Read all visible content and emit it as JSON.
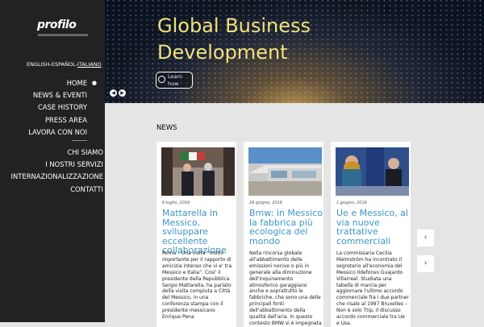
{
  "sidebar": {
    "logo": "profilo",
    "languages": {
      "text": "ENGLISH-ESPAÑOL-",
      "active": "ITALIANO"
    },
    "menu_primary": [
      "HOME",
      "NEWS & EVENTI",
      "CASE HISTORY",
      "PRESS AREA",
      "LAVORA CON NOI"
    ],
    "menu_secondary": [
      "CHI SIAMO",
      "I NOSTRI SERVIZI",
      "INTERNAZIONALIZZAZIONE",
      "CONTATTI"
    ]
  },
  "hero": {
    "title": "Global Business Development",
    "button": "Learn how"
  },
  "news": {
    "title": "NEWS",
    "cards": [
      {
        "date": "6 luglio, 2016",
        "title": "Mattarella in Messico, sviluppare eccellente collaborazione",
        "body": "Roma – Una visita “molto importante per il rapporto di amicizia intenso che vi e' tra Messico e Italia”. Cosi' il presidente della Repubblica Sergio Mattarella, ha parlato della visita compiuta a Città del Messico, in una conferenza stampa con il presidente messicano Enrique Pena"
      },
      {
        "date": "29 giugno, 2016",
        "title": "Bmw: in Messico la fabbrica più ecologica del mondo",
        "body": "Nella rincorsa globale all'abbattimento delle emissioni nocive o più in generale alla diminuzione dell'inquinamento atmosferico garaggiano anche e soprattutto le fabbriche, che sono una delle principali fonti dell'abbattimento della qualità dell'aria. In questo contesto BMW si è impegnata per"
      },
      {
        "date": "1 giugno, 2016",
        "title": "Ue e Messico, al via nuove trattative commerciali",
        "body": "La commissaria Cecilia Malmström ha incontrato il segretario all'economia del Messico Ildefonso Guajardo Villarreal. Studiata una tabella di marcia per aggiornare l'ultimo accordo commerciale fra i due partner che risale al 1997 Bruxelles – Non è solo Ttip, il discusso accordo commerciale tra Ue e Usa."
      }
    ]
  }
}
